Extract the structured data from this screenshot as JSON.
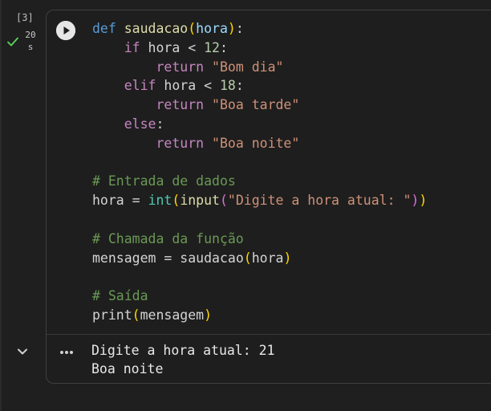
{
  "cell": {
    "execution_count": "[3]",
    "duration_value": "20",
    "duration_unit": "s",
    "status": "success",
    "run_icon": "play-circle-icon",
    "collapse_icon": "chevron-down-icon",
    "output_menu_icon": "more-horizontal-icon",
    "code_lines": [
      [
        {
          "t": "def",
          "c": "kw"
        },
        {
          "t": " ",
          "c": "plain"
        },
        {
          "t": "saudacao",
          "c": "fn"
        },
        {
          "t": "(",
          "c": "p1"
        },
        {
          "t": "hora",
          "c": "var"
        },
        {
          "t": ")",
          "c": "p1"
        },
        {
          "t": ":",
          "c": "plain"
        }
      ],
      [
        {
          "t": "    ",
          "c": "plain"
        },
        {
          "t": "if",
          "c": "ctl"
        },
        {
          "t": " hora ",
          "c": "plain"
        },
        {
          "t": "<",
          "c": "plain"
        },
        {
          "t": " ",
          "c": "plain"
        },
        {
          "t": "12",
          "c": "num"
        },
        {
          "t": ":",
          "c": "plain"
        }
      ],
      [
        {
          "t": "        ",
          "c": "plain"
        },
        {
          "t": "return",
          "c": "ctl"
        },
        {
          "t": " ",
          "c": "plain"
        },
        {
          "t": "\"Bom dia\"",
          "c": "str"
        }
      ],
      [
        {
          "t": "    ",
          "c": "plain"
        },
        {
          "t": "elif",
          "c": "ctl"
        },
        {
          "t": " hora ",
          "c": "plain"
        },
        {
          "t": "<",
          "c": "plain"
        },
        {
          "t": " ",
          "c": "plain"
        },
        {
          "t": "18",
          "c": "num"
        },
        {
          "t": ":",
          "c": "plain"
        }
      ],
      [
        {
          "t": "        ",
          "c": "plain"
        },
        {
          "t": "return",
          "c": "ctl"
        },
        {
          "t": " ",
          "c": "plain"
        },
        {
          "t": "\"Boa tarde\"",
          "c": "str"
        }
      ],
      [
        {
          "t": "    ",
          "c": "plain"
        },
        {
          "t": "else",
          "c": "ctl"
        },
        {
          "t": ":",
          "c": "plain"
        }
      ],
      [
        {
          "t": "        ",
          "c": "plain"
        },
        {
          "t": "return",
          "c": "ctl"
        },
        {
          "t": " ",
          "c": "plain"
        },
        {
          "t": "\"Boa noite\"",
          "c": "str"
        }
      ],
      [
        {
          "t": "",
          "c": "plain"
        }
      ],
      [
        {
          "t": "# Entrada de dados",
          "c": "cmt"
        }
      ],
      [
        {
          "t": "hora",
          "c": "plain"
        },
        {
          "t": " = ",
          "c": "plain"
        },
        {
          "t": "int",
          "c": "builtin"
        },
        {
          "t": "(",
          "c": "p1"
        },
        {
          "t": "input",
          "c": "fn"
        },
        {
          "t": "(",
          "c": "p2"
        },
        {
          "t": "\"Digite a hora atual: \"",
          "c": "str"
        },
        {
          "t": ")",
          "c": "p2"
        },
        {
          "t": ")",
          "c": "p1"
        }
      ],
      [
        {
          "t": "",
          "c": "plain"
        }
      ],
      [
        {
          "t": "# Chamada da função",
          "c": "cmt"
        }
      ],
      [
        {
          "t": "mensagem",
          "c": "plain"
        },
        {
          "t": " = ",
          "c": "plain"
        },
        {
          "t": "saudacao",
          "c": "plain"
        },
        {
          "t": "(",
          "c": "p1"
        },
        {
          "t": "hora",
          "c": "plain"
        },
        {
          "t": ")",
          "c": "p1"
        }
      ],
      [
        {
          "t": "",
          "c": "plain"
        }
      ],
      [
        {
          "t": "# Saída",
          "c": "cmt"
        }
      ],
      [
        {
          "t": "print",
          "c": "plain"
        },
        {
          "t": "(",
          "c": "p1"
        },
        {
          "t": "mensagem",
          "c": "plain"
        },
        {
          "t": ")",
          "c": "p1"
        }
      ]
    ],
    "output_lines": [
      "Digite a hora atual: 21",
      "Boa noite"
    ]
  },
  "colors": {
    "background": "#1f1f1f",
    "check": "#5fd35f",
    "keyword": "#569cd6",
    "control": "#c586c0",
    "function": "#dcdcaa",
    "string": "#ce9178",
    "comment": "#6a9955",
    "number": "#b5cea8",
    "bracket_1": "#ffd700",
    "bracket_2": "#da70d6"
  }
}
